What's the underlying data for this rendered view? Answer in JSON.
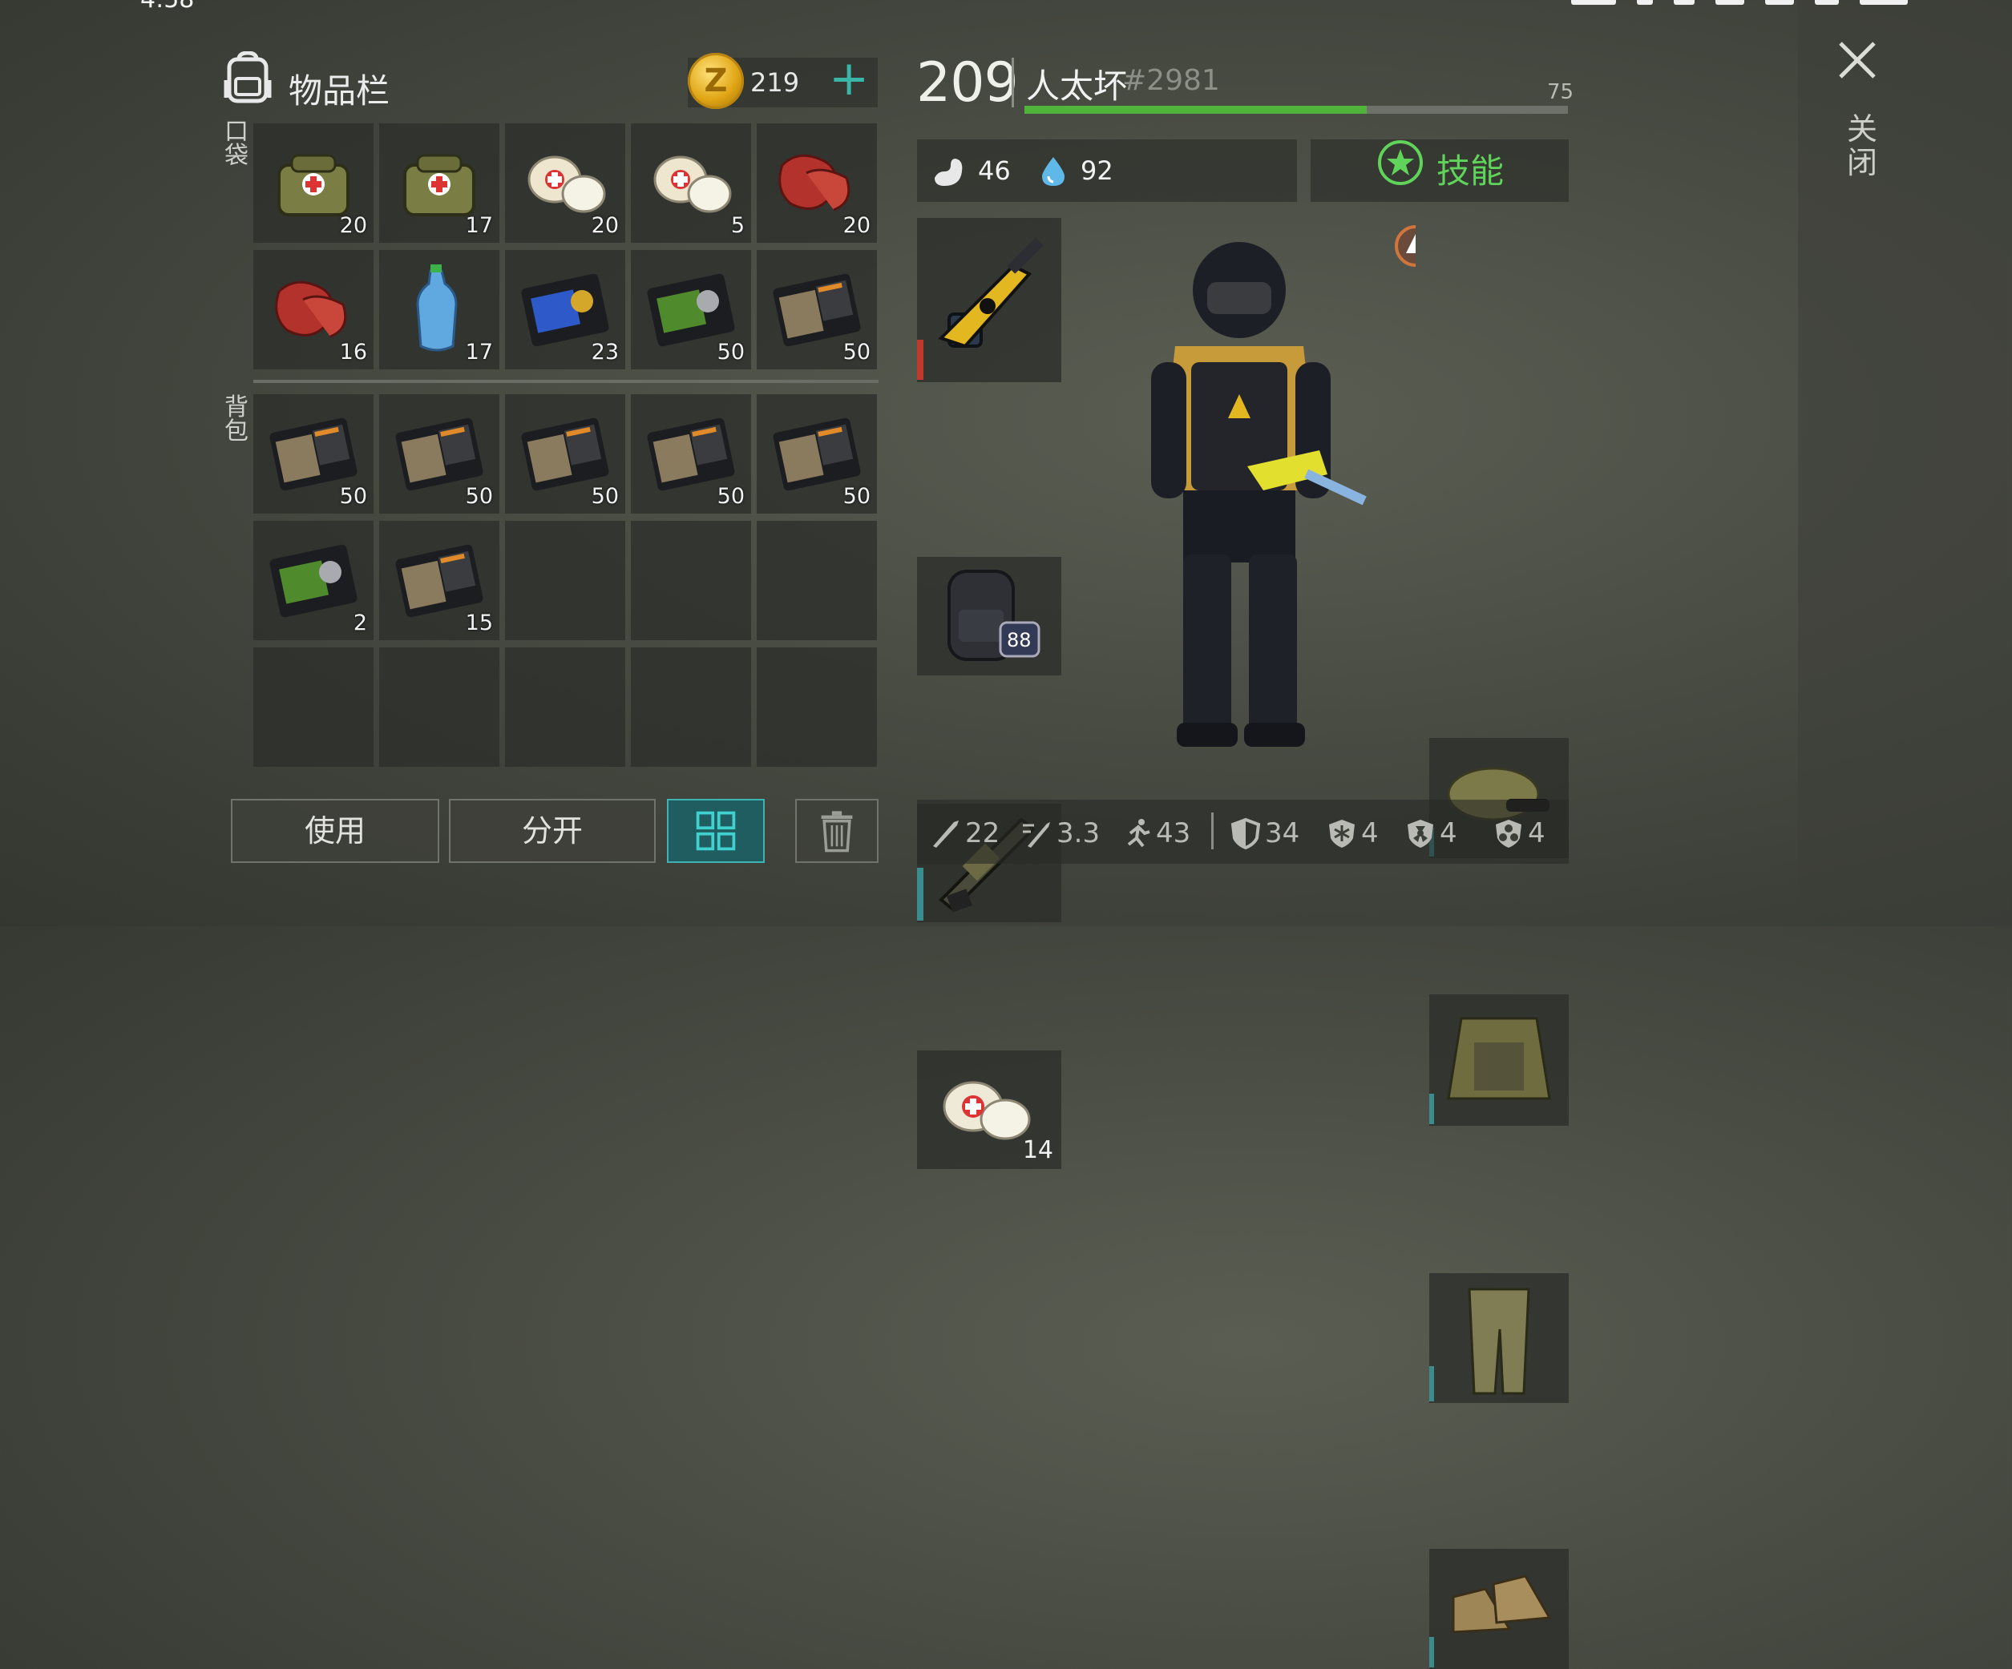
{
  "status": {
    "time": "4:58"
  },
  "inventory": {
    "title": "物品栏",
    "coins": "219",
    "add_label": "+",
    "pocket_label": "口袋",
    "backpack_label": "背包",
    "pocket_slots": [
      {
        "item": "medical-bag",
        "qty": "20"
      },
      {
        "item": "medical-bag",
        "qty": "17"
      },
      {
        "item": "bandage",
        "qty": "20"
      },
      {
        "item": "bandage",
        "qty": "5"
      },
      {
        "item": "raw-meat",
        "qty": "20"
      },
      {
        "item": "raw-meat",
        "qty": "16"
      },
      {
        "item": "water-bottle",
        "qty": "17"
      },
      {
        "item": "police-badge-blue",
        "qty": "23"
      },
      {
        "item": "id-card-green",
        "qty": "50"
      },
      {
        "item": "patrol-officer-card",
        "qty": "50"
      }
    ],
    "backpack_slots": [
      {
        "item": "patrol-officer-card",
        "qty": "50"
      },
      {
        "item": "patrol-officer-card",
        "qty": "50"
      },
      {
        "item": "patrol-officer-card",
        "qty": "50"
      },
      {
        "item": "patrol-officer-card",
        "qty": "50"
      },
      {
        "item": "patrol-officer-card",
        "qty": "50"
      },
      {
        "item": "id-card-green",
        "qty": "2"
      },
      {
        "item": "patrol-officer-card",
        "qty": "15"
      },
      {
        "item": "",
        "qty": ""
      },
      {
        "item": "",
        "qty": ""
      },
      {
        "item": "",
        "qty": ""
      },
      {
        "item": "",
        "qty": ""
      },
      {
        "item": "",
        "qty": ""
      },
      {
        "item": "",
        "qty": ""
      },
      {
        "item": "",
        "qty": ""
      },
      {
        "item": "",
        "qty": ""
      }
    ],
    "buttons": {
      "use": "使用",
      "split": "分开"
    }
  },
  "player": {
    "level": "209",
    "name": "人太坏",
    "id": "#2981",
    "xp_max_level": "75",
    "xp_fraction": 0.63,
    "hunger": "46",
    "thirst": "92",
    "skills_label": "技能"
  },
  "equipment": {
    "left": [
      {
        "item": "smg-weapon",
        "qty": "",
        "durability": 0.3,
        "dur_color": "#c0392b"
      },
      {
        "item": "backpack",
        "qty": "",
        "badge": "88",
        "durability": 0,
        "dur_color": "#3a8d8f"
      },
      {
        "item": "grenade-launcher",
        "qty": "",
        "durability": 0.4,
        "dur_color": "#3a8d8f"
      },
      {
        "item": "bandage",
        "qty": "14",
        "durability": 0,
        "dur_color": "#3a8d8f"
      }
    ],
    "right": [
      {
        "item": "camo-cap",
        "durability": 0.25
      },
      {
        "item": "camo-vest",
        "durability": 0.25
      },
      {
        "item": "camo-pants",
        "durability": 0.25
      },
      {
        "item": "boots",
        "durability": 0.25
      }
    ]
  },
  "stats": {
    "melee_damage": "22",
    "melee_speed": "3.3",
    "move_speed": "43",
    "armor": "34",
    "cold_resist": "4",
    "radiation_resist": "4",
    "bio_resist": "4"
  },
  "close_label": "关闭",
  "colors": {
    "accent": "#3fb3b4",
    "xp": "#4fb33c",
    "skill": "#5fd35a",
    "coin": "#e0a514"
  }
}
